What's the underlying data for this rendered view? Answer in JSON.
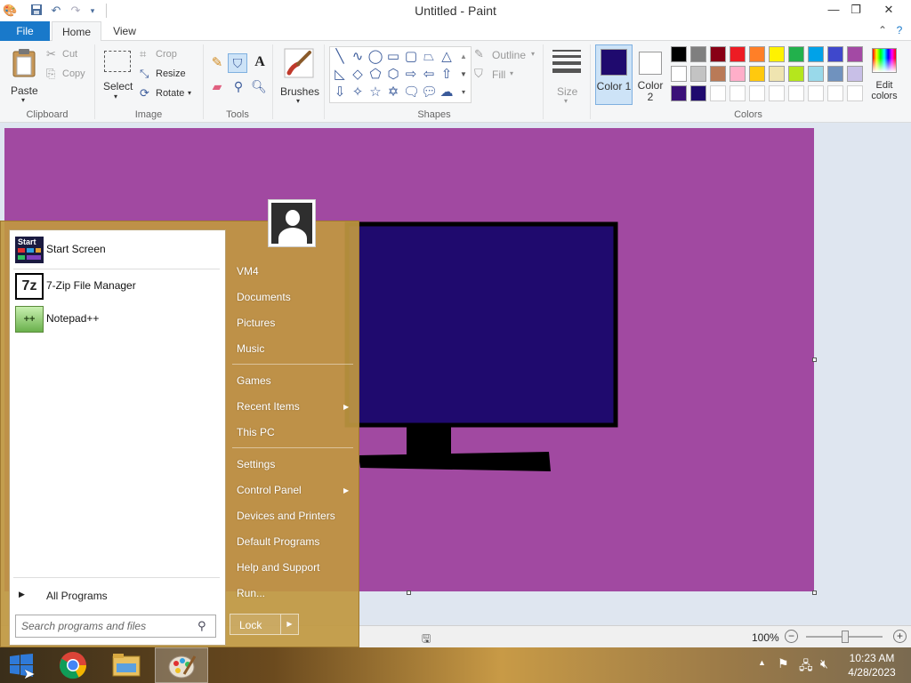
{
  "window": {
    "title": "Untitled - Paint",
    "quick_access": [
      "paint-app-icon",
      "save-icon",
      "undo-icon",
      "redo-icon",
      "customize-icon"
    ]
  },
  "tabs": {
    "file": "File",
    "home": "Home",
    "view": "View",
    "active": "Home"
  },
  "ribbon": {
    "clipboard": {
      "label": "Clipboard",
      "paste": "Paste",
      "cut": "Cut",
      "copy": "Copy"
    },
    "image": {
      "label": "Image",
      "select": "Select",
      "crop": "Crop",
      "resize": "Resize",
      "rotate": "Rotate"
    },
    "tools": {
      "label": "Tools"
    },
    "brushes": {
      "label": "Brushes"
    },
    "shapes": {
      "label": "Shapes",
      "outline": "Outline",
      "fill": "Fill"
    },
    "size": {
      "label": "Size"
    },
    "colors": {
      "label": "Colors",
      "color1": "Color 1",
      "color2": "Color 2",
      "edit": "Edit colors",
      "color1_value": "#1f0a6e",
      "color2_value": "#ffffff",
      "palette_row1": [
        "#000000",
        "#7f7f7f",
        "#880015",
        "#ed1c24",
        "#ff7f27",
        "#fff200",
        "#22b14c",
        "#00a2e8",
        "#3f48cc",
        "#a349a4"
      ],
      "palette_row2": [
        "#ffffff",
        "#c3c3c3",
        "#b97a57",
        "#ffaec9",
        "#ffc90e",
        "#efe4b0",
        "#b5e61d",
        "#99d9ea",
        "#7092be",
        "#c8bfe7"
      ],
      "palette_row3": [
        "#3a1078",
        "#1f0a6e",
        "#ffffff",
        "#ffffff",
        "#ffffff",
        "#ffffff",
        "#ffffff",
        "#ffffff",
        "#ffffff",
        "#ffffff"
      ]
    }
  },
  "canvas": {
    "background": "#a149a1",
    "monitor_screen": "#1f0a6e"
  },
  "statusbar": {
    "zoom": "100%"
  },
  "startmenu": {
    "programs": [
      {
        "label": "Start Screen",
        "icon": "start-screen-icon"
      },
      {
        "label": "7-Zip File Manager",
        "icon": "7zip-icon"
      },
      {
        "label": "Notepad++",
        "icon": "notepadpp-icon"
      }
    ],
    "all_programs": "All Programs",
    "search_placeholder": "Search programs and files",
    "links": {
      "user": "VM4",
      "documents": "Documents",
      "pictures": "Pictures",
      "music": "Music",
      "games": "Games",
      "recent_items": "Recent Items",
      "this_pc": "This PC",
      "settings": "Settings",
      "control_panel": "Control Panel",
      "devices": "Devices and Printers",
      "default_programs": "Default Programs",
      "help": "Help and Support",
      "run": "Run..."
    },
    "lock": "Lock"
  },
  "taskbar": {
    "apps": [
      "start-button",
      "chrome-icon",
      "file-explorer-icon",
      "paint-icon"
    ],
    "time": "10:23 AM",
    "date": "4/28/2023"
  }
}
